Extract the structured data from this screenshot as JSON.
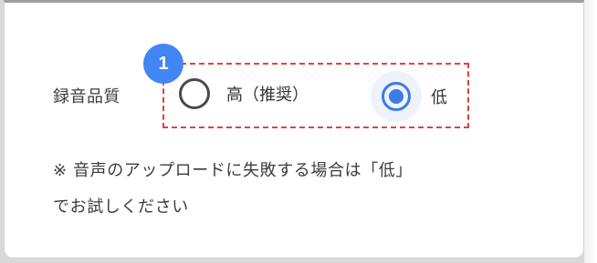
{
  "recording_quality": {
    "label": "録音品質",
    "step_badge": "1",
    "options": [
      {
        "label": "高（推奨）",
        "selected": false
      },
      {
        "label": "低",
        "selected": true
      }
    ]
  },
  "note": {
    "line1": "※ 音声のアップロードに失敗する場合は「低」",
    "line2": "でお試しください"
  },
  "colors": {
    "accent": "#3d7be6",
    "badge": "#4285f4",
    "highlight_border": "#e0433a"
  }
}
